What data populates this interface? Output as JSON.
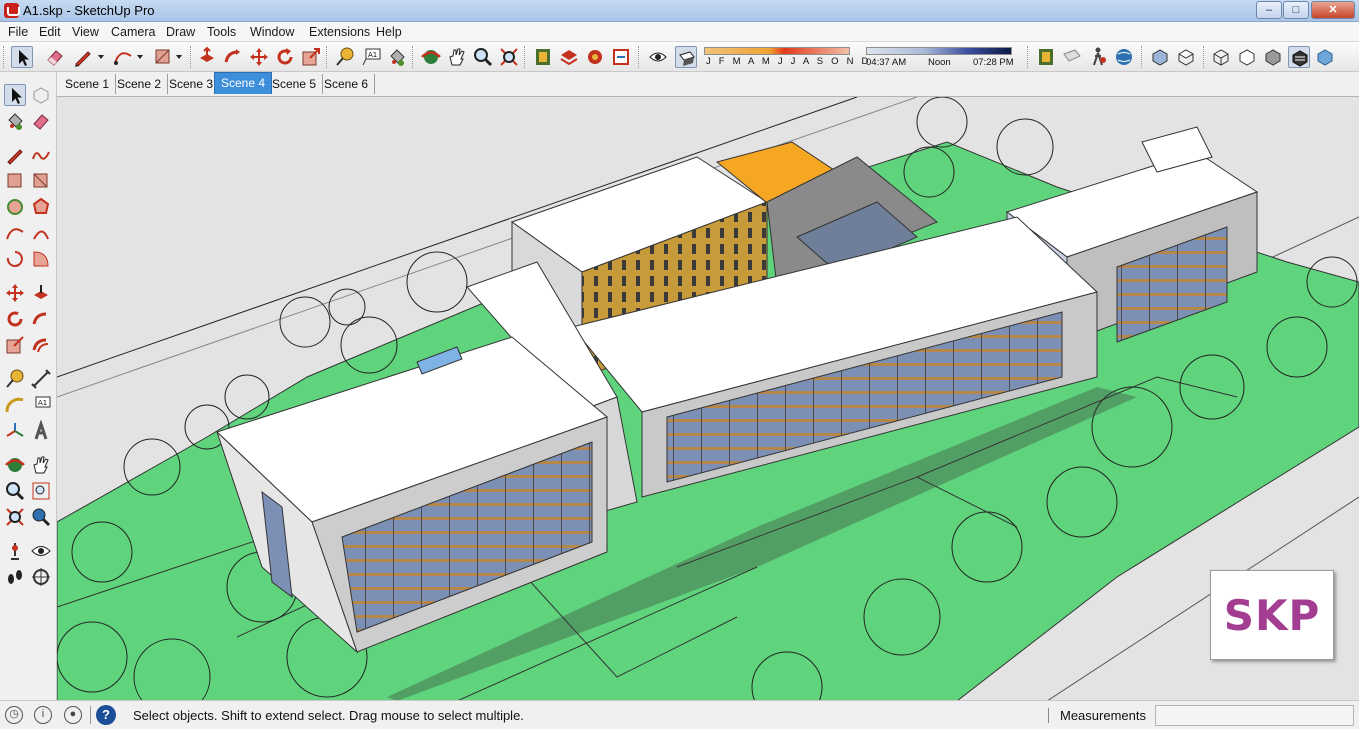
{
  "window": {
    "title": "A1.skp - SketchUp Pro",
    "minimize": "–",
    "maximize": "□",
    "close": "✕"
  },
  "menu": [
    "File",
    "Edit",
    "View",
    "Camera",
    "Draw",
    "Tools",
    "Window",
    "Extensions",
    "Help"
  ],
  "shadow_settings": {
    "months": "J F M A M J J A S O N D",
    "time_start": "04:37 AM",
    "time_mid": "Noon",
    "time_end": "07:28 PM"
  },
  "scenes": {
    "tabs": [
      "Scene 1",
      "Scene 2",
      "Scene 3",
      "Scene 4",
      "Scene 5",
      "Scene 6"
    ],
    "active": "Scene 4"
  },
  "logo": {
    "text": "SKP",
    "color": "#a23d92"
  },
  "status": {
    "help": "?",
    "message": "Select objects. Shift to extend select. Drag mouse to select multiple.",
    "measurements_label": "Measurements",
    "measurements_value": ""
  },
  "colors": {
    "grass": "#5fd47c",
    "roof": "#ffffff",
    "orange_roof": "#f5a623",
    "ochre_wall": "#c79a3a",
    "glass": "#7c8fb5",
    "ground": "#e3e3e3",
    "active_tab": "#3d8fdb"
  }
}
